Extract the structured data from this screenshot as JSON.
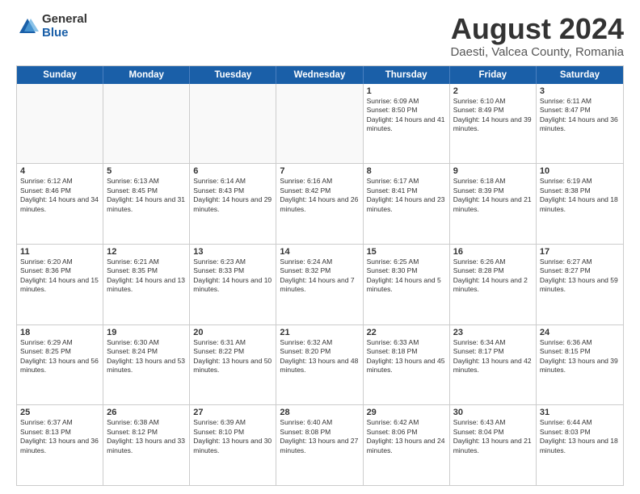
{
  "logo": {
    "general": "General",
    "blue": "Blue"
  },
  "title": "August 2024",
  "subtitle": "Daesti, Valcea County, Romania",
  "header_days": [
    "Sunday",
    "Monday",
    "Tuesday",
    "Wednesday",
    "Thursday",
    "Friday",
    "Saturday"
  ],
  "weeks": [
    [
      {
        "day": "",
        "info": ""
      },
      {
        "day": "",
        "info": ""
      },
      {
        "day": "",
        "info": ""
      },
      {
        "day": "",
        "info": ""
      },
      {
        "day": "1",
        "info": "Sunrise: 6:09 AM\nSunset: 8:50 PM\nDaylight: 14 hours and 41 minutes."
      },
      {
        "day": "2",
        "info": "Sunrise: 6:10 AM\nSunset: 8:49 PM\nDaylight: 14 hours and 39 minutes."
      },
      {
        "day": "3",
        "info": "Sunrise: 6:11 AM\nSunset: 8:47 PM\nDaylight: 14 hours and 36 minutes."
      }
    ],
    [
      {
        "day": "4",
        "info": "Sunrise: 6:12 AM\nSunset: 8:46 PM\nDaylight: 14 hours and 34 minutes."
      },
      {
        "day": "5",
        "info": "Sunrise: 6:13 AM\nSunset: 8:45 PM\nDaylight: 14 hours and 31 minutes."
      },
      {
        "day": "6",
        "info": "Sunrise: 6:14 AM\nSunset: 8:43 PM\nDaylight: 14 hours and 29 minutes."
      },
      {
        "day": "7",
        "info": "Sunrise: 6:16 AM\nSunset: 8:42 PM\nDaylight: 14 hours and 26 minutes."
      },
      {
        "day": "8",
        "info": "Sunrise: 6:17 AM\nSunset: 8:41 PM\nDaylight: 14 hours and 23 minutes."
      },
      {
        "day": "9",
        "info": "Sunrise: 6:18 AM\nSunset: 8:39 PM\nDaylight: 14 hours and 21 minutes."
      },
      {
        "day": "10",
        "info": "Sunrise: 6:19 AM\nSunset: 8:38 PM\nDaylight: 14 hours and 18 minutes."
      }
    ],
    [
      {
        "day": "11",
        "info": "Sunrise: 6:20 AM\nSunset: 8:36 PM\nDaylight: 14 hours and 15 minutes."
      },
      {
        "day": "12",
        "info": "Sunrise: 6:21 AM\nSunset: 8:35 PM\nDaylight: 14 hours and 13 minutes."
      },
      {
        "day": "13",
        "info": "Sunrise: 6:23 AM\nSunset: 8:33 PM\nDaylight: 14 hours and 10 minutes."
      },
      {
        "day": "14",
        "info": "Sunrise: 6:24 AM\nSunset: 8:32 PM\nDaylight: 14 hours and 7 minutes."
      },
      {
        "day": "15",
        "info": "Sunrise: 6:25 AM\nSunset: 8:30 PM\nDaylight: 14 hours and 5 minutes."
      },
      {
        "day": "16",
        "info": "Sunrise: 6:26 AM\nSunset: 8:28 PM\nDaylight: 14 hours and 2 minutes."
      },
      {
        "day": "17",
        "info": "Sunrise: 6:27 AM\nSunset: 8:27 PM\nDaylight: 13 hours and 59 minutes."
      }
    ],
    [
      {
        "day": "18",
        "info": "Sunrise: 6:29 AM\nSunset: 8:25 PM\nDaylight: 13 hours and 56 minutes."
      },
      {
        "day": "19",
        "info": "Sunrise: 6:30 AM\nSunset: 8:24 PM\nDaylight: 13 hours and 53 minutes."
      },
      {
        "day": "20",
        "info": "Sunrise: 6:31 AM\nSunset: 8:22 PM\nDaylight: 13 hours and 50 minutes."
      },
      {
        "day": "21",
        "info": "Sunrise: 6:32 AM\nSunset: 8:20 PM\nDaylight: 13 hours and 48 minutes."
      },
      {
        "day": "22",
        "info": "Sunrise: 6:33 AM\nSunset: 8:18 PM\nDaylight: 13 hours and 45 minutes."
      },
      {
        "day": "23",
        "info": "Sunrise: 6:34 AM\nSunset: 8:17 PM\nDaylight: 13 hours and 42 minutes."
      },
      {
        "day": "24",
        "info": "Sunrise: 6:36 AM\nSunset: 8:15 PM\nDaylight: 13 hours and 39 minutes."
      }
    ],
    [
      {
        "day": "25",
        "info": "Sunrise: 6:37 AM\nSunset: 8:13 PM\nDaylight: 13 hours and 36 minutes."
      },
      {
        "day": "26",
        "info": "Sunrise: 6:38 AM\nSunset: 8:12 PM\nDaylight: 13 hours and 33 minutes."
      },
      {
        "day": "27",
        "info": "Sunrise: 6:39 AM\nSunset: 8:10 PM\nDaylight: 13 hours and 30 minutes."
      },
      {
        "day": "28",
        "info": "Sunrise: 6:40 AM\nSunset: 8:08 PM\nDaylight: 13 hours and 27 minutes."
      },
      {
        "day": "29",
        "info": "Sunrise: 6:42 AM\nSunset: 8:06 PM\nDaylight: 13 hours and 24 minutes."
      },
      {
        "day": "30",
        "info": "Sunrise: 6:43 AM\nSunset: 8:04 PM\nDaylight: 13 hours and 21 minutes."
      },
      {
        "day": "31",
        "info": "Sunrise: 6:44 AM\nSunset: 8:03 PM\nDaylight: 13 hours and 18 minutes."
      }
    ]
  ]
}
